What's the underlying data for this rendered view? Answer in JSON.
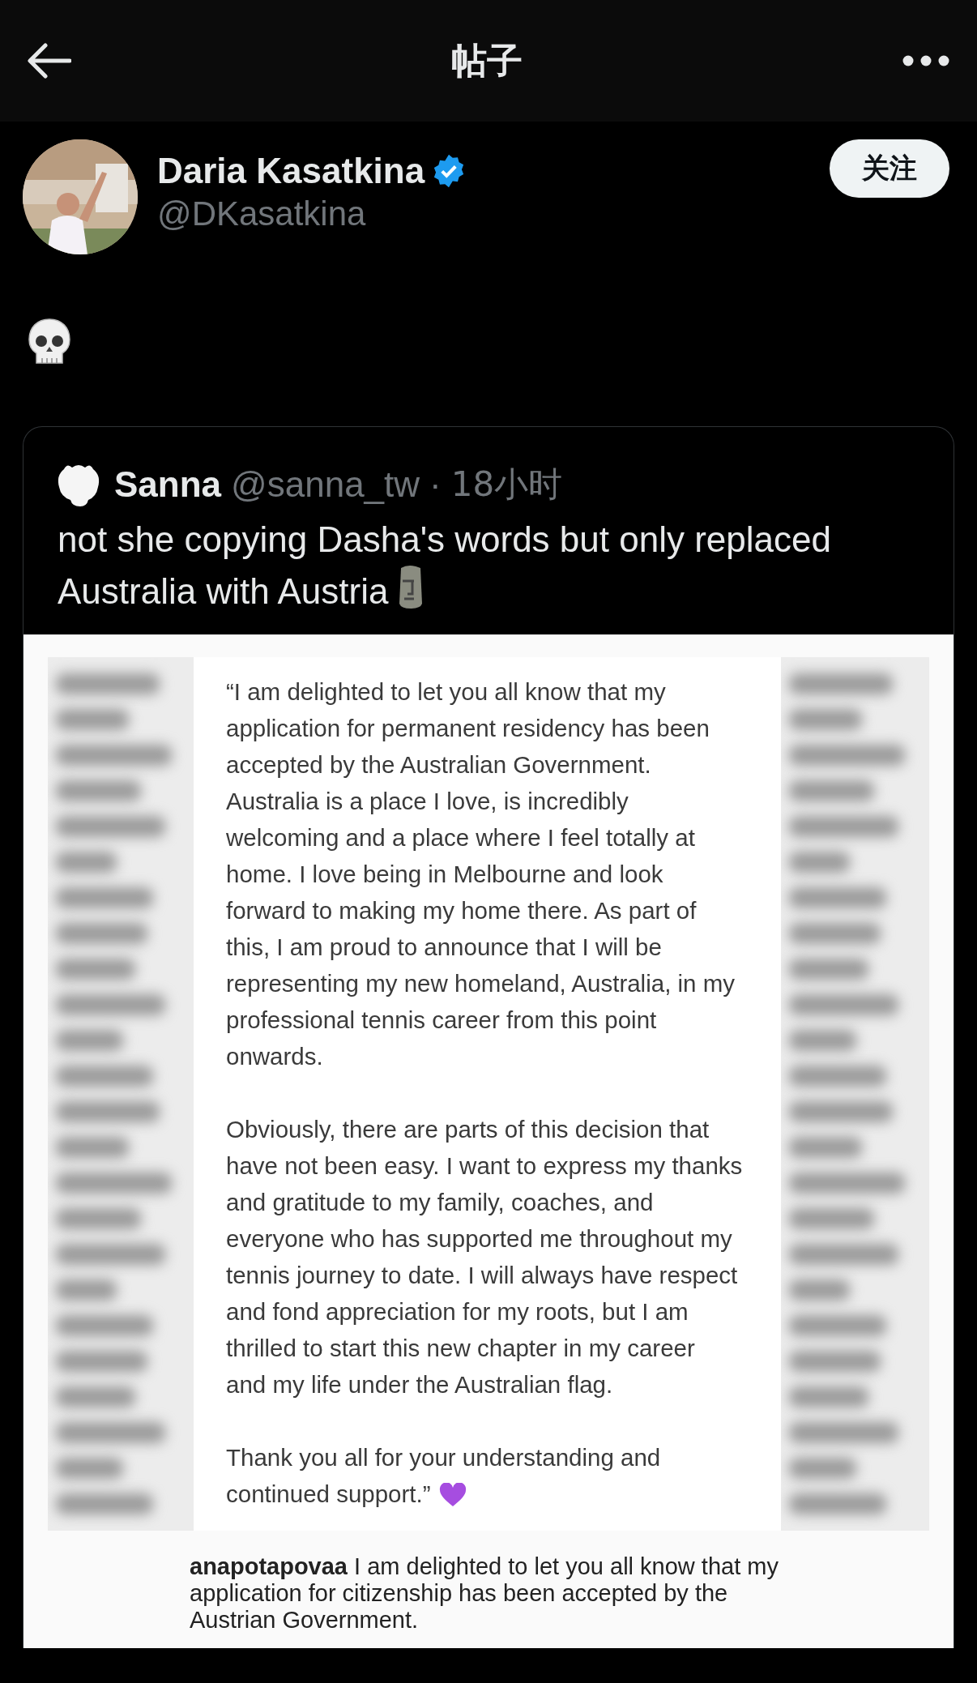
{
  "header": {
    "title": "帖子"
  },
  "post": {
    "author": {
      "name": "Daria Kasatkina",
      "verified": true,
      "handle": "@DKasatkina"
    },
    "follow_button": "关注",
    "quote": {
      "name": "Sanna",
      "handle": "@sanna_tw",
      "separator": "·",
      "time": "18小时",
      "text_lines": [
        "not she copying Dasha's words but only replaced",
        "Australia with Austria"
      ],
      "image": {
        "paragraphs": [
          [
            "“I am delighted to let you all know that my",
            "application for permanent residency has been",
            "accepted by the Australian Government.",
            "Australia is a place I love,  is incredibly",
            "welcoming and a place where I feel totally at",
            "home. I love being in Melbourne and look",
            "forward to making my home there. As part of",
            "this, I am proud to announce that I will be",
            "representing my new homeland, Australia, in my",
            "professional tennis career from this point",
            "onwards."
          ],
          [
            "Obviously, there are parts of this decision that",
            "have not been easy. I want to express my thanks",
            "and gratitude to my family, coaches, and",
            "everyone who has supported me throughout my",
            "tennis journey to date. I will always have respect",
            "and fond appreciation for my roots, but I am",
            "thrilled to start this new chapter in my career",
            "and my life under the Australian flag."
          ],
          [
            "Thank you all for your understanding and",
            "continued support.”"
          ]
        ],
        "caption": "**anapotapovaa** I am delighted to let you all know that my application for citizenship has been accepted by the Austrian Government."
      }
    }
  }
}
